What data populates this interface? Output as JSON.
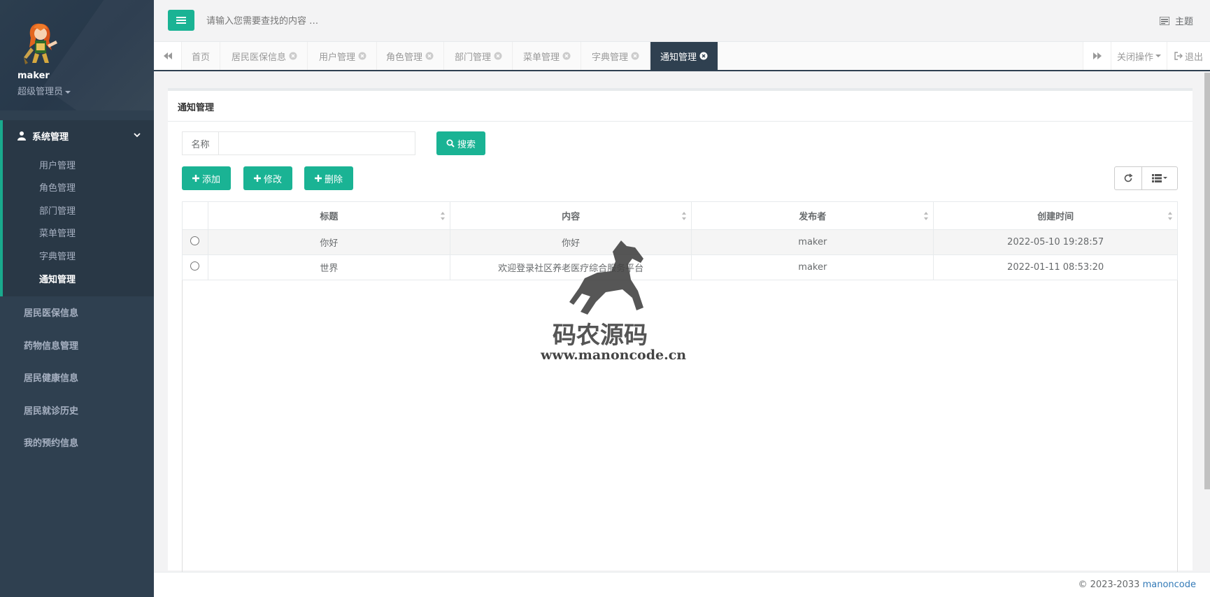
{
  "user": {
    "name": "maker",
    "role": "超级管理员"
  },
  "sidebar": {
    "group": {
      "label": "系统管理",
      "items": [
        "用户管理",
        "角色管理",
        "部门管理",
        "菜单管理",
        "字典管理",
        "通知管理"
      ]
    },
    "items": [
      "居民医保信息",
      "药物信息管理",
      "居民健康信息",
      "居民就诊历史",
      "我的预约信息"
    ]
  },
  "topbar": {
    "search_placeholder": "请输入您需要查找的内容 …",
    "theme_label": "主题"
  },
  "tabs": [
    "首页",
    "居民医保信息",
    "用户管理",
    "角色管理",
    "部门管理",
    "菜单管理",
    "字典管理",
    "通知管理"
  ],
  "tab_actions": {
    "close_ops": "关闭操作",
    "logout": "退出"
  },
  "panel": {
    "title": "通知管理",
    "search_label": "名称",
    "search_button": "搜索",
    "add_button": "添加",
    "edit_button": "修改",
    "delete_button": "删除"
  },
  "table": {
    "headers": [
      "标题",
      "内容",
      "发布者",
      "创建时间"
    ],
    "rows": [
      {
        "title": "你好",
        "content": "你好",
        "publisher": "maker",
        "created": "2022-05-10 19:28:57"
      },
      {
        "title": "世界",
        "content": "欢迎登录社区养老医疗综合服务平台",
        "publisher": "maker",
        "created": "2022-01-11 08:53:20"
      }
    ]
  },
  "watermark": {
    "title": "码农源码",
    "url": "www.manoncode.cn"
  },
  "footer": {
    "copyright": "© 2023-2033 ",
    "link": "manoncode"
  },
  "colors": {
    "accent": "#1ab394",
    "sidebar": "#2f4050"
  }
}
